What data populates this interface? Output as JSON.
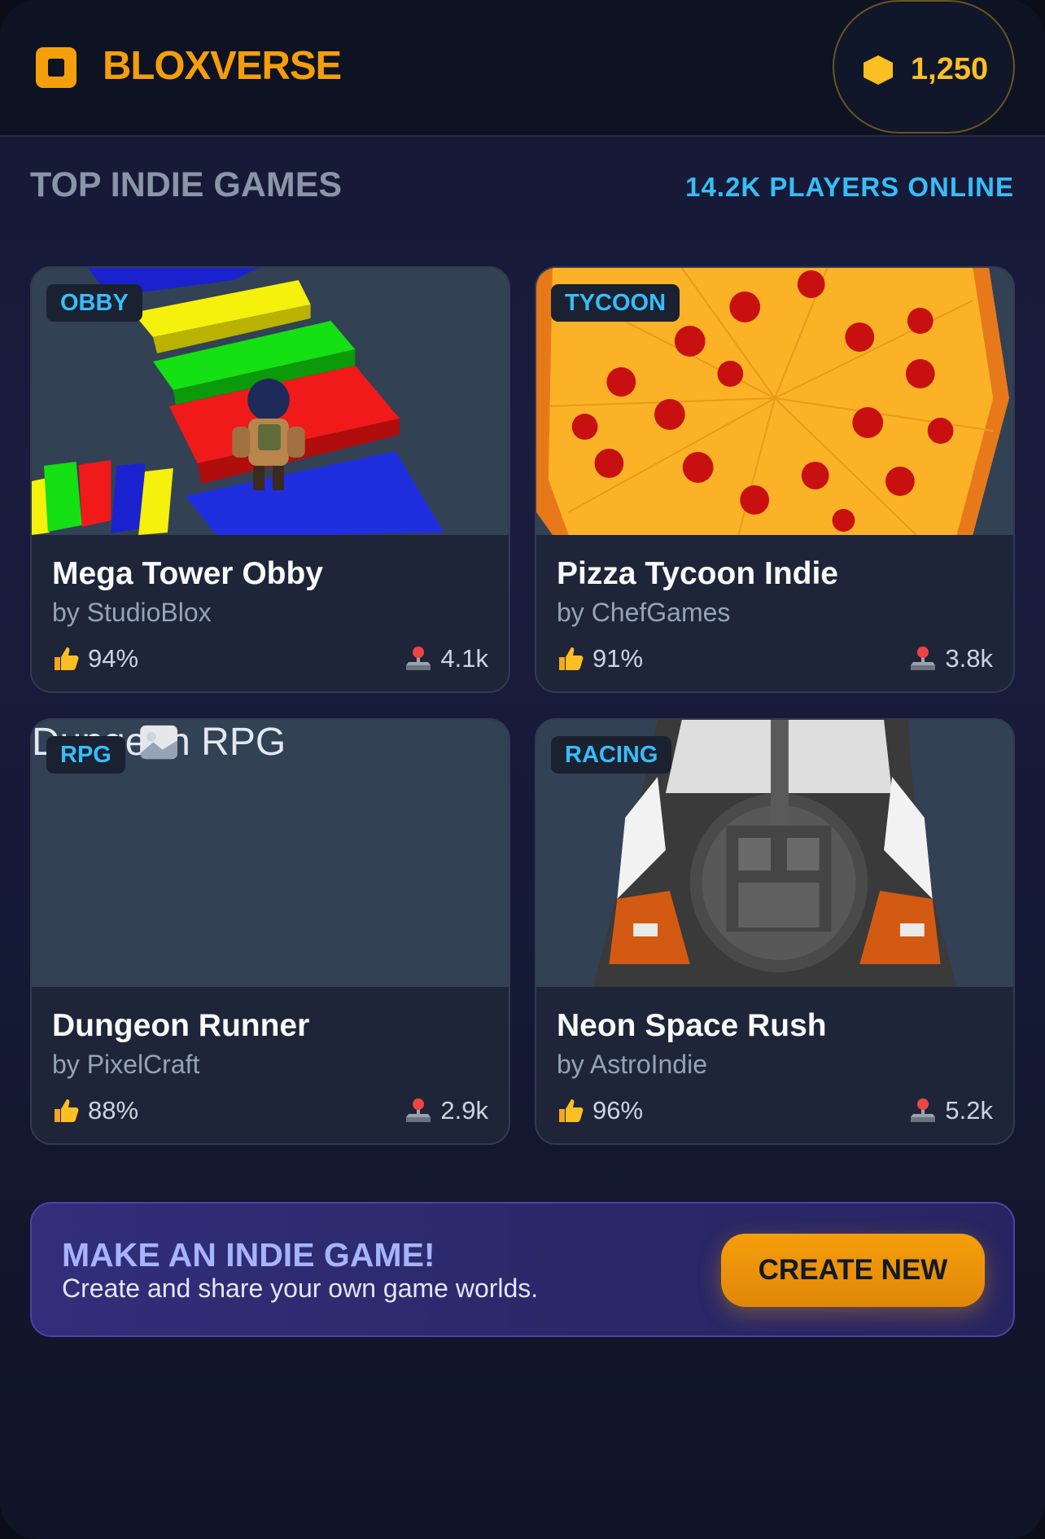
{
  "header": {
    "brand": "BLOXVERSE",
    "coins": "1,250"
  },
  "section": {
    "title": "TOP INDIE GAMES",
    "players_online": "14.2K PLAYERS ONLINE"
  },
  "games": [
    {
      "badge": "OBBY",
      "title": "Mega Tower Obby",
      "author": "by StudioBlox",
      "rating": "94%",
      "playing": "4.1k"
    },
    {
      "badge": "TYCOON",
      "title": "Pizza Tycoon Indie",
      "author": "by ChefGames",
      "rating": "91%",
      "playing": "3.8k"
    },
    {
      "badge": "RPG",
      "title": "Dungeon Runner",
      "author": "by PixelCraft",
      "rating": "88%",
      "playing": "2.9k",
      "image_alt": "Dungeon RPG"
    },
    {
      "badge": "RACING",
      "title": "Neon Space Rush",
      "author": "by AstroIndie",
      "rating": "96%",
      "playing": "5.2k"
    }
  ],
  "promo": {
    "title": "MAKE AN INDIE GAME!",
    "subtitle": "Create and share your own game worlds.",
    "button": "CREATE NEW"
  },
  "colors": {
    "accent": "#f59e0b",
    "badge_text": "#38bdf8",
    "card_bg": "#1e2538"
  }
}
